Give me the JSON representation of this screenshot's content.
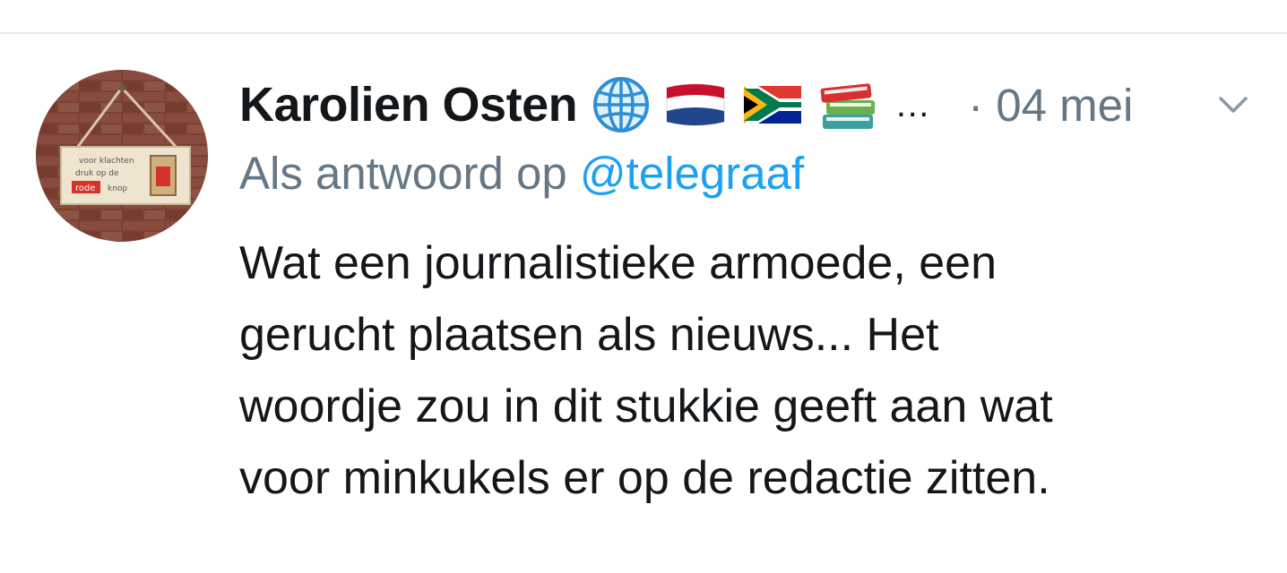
{
  "tweet": {
    "author": {
      "display_name": "Karolien Osten",
      "name_emojis": [
        "globe-icon",
        "netherlands-flag-icon",
        "south-africa-flag-icon",
        "books-icon"
      ],
      "truncation": "…"
    },
    "avatar": {
      "sign_text_line1": "voor klachten",
      "sign_text_line2": "druk op de",
      "sign_text_red": "rode",
      "sign_text_knop": "knop"
    },
    "timestamp": "· 04 mei",
    "reply_prefix": "Als antwoord op",
    "reply_handle": "@telegraaf",
    "body_lines": [
      "Wat een journalistieke armoede, een",
      "gerucht plaatsen als nieuws... Het",
      "woordje zou in dit stukkie geeft aan wat",
      "voor minkukels er op de redactie zitten."
    ],
    "menu_icon": "chevron-down-icon"
  },
  "colors": {
    "text_primary": "#14171a",
    "text_secondary": "#657786",
    "link": "#1da1f2",
    "divider": "#e6ecf0"
  }
}
